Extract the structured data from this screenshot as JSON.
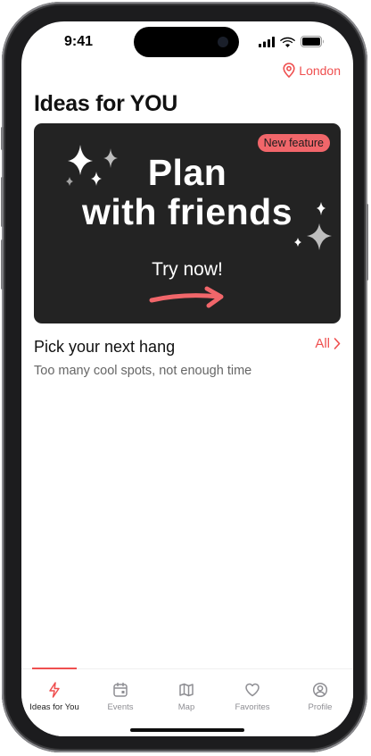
{
  "status_bar": {
    "time": "9:41"
  },
  "location": {
    "label": "London"
  },
  "page": {
    "title": "Ideas for YOU"
  },
  "banner": {
    "badge": "New feature",
    "headline_line1": "Plan",
    "headline_line2": "with friends",
    "cta": "Try now!"
  },
  "section": {
    "title": "Pick your next hang",
    "subtitle": "Too many cool spots, not enough time",
    "all_label": "All"
  },
  "tabs": [
    {
      "label": "Ideas for You",
      "icon": "bolt-icon",
      "active": true
    },
    {
      "label": "Events",
      "icon": "calendar-icon",
      "active": false
    },
    {
      "label": "Map",
      "icon": "map-icon",
      "active": false
    },
    {
      "label": "Favorites",
      "icon": "heart-icon",
      "active": false
    },
    {
      "label": "Profile",
      "icon": "person-icon",
      "active": false
    }
  ],
  "colors": {
    "accent": "#ef4f4f",
    "banner_bg": "#232323",
    "badge_bg": "#f1666a"
  }
}
